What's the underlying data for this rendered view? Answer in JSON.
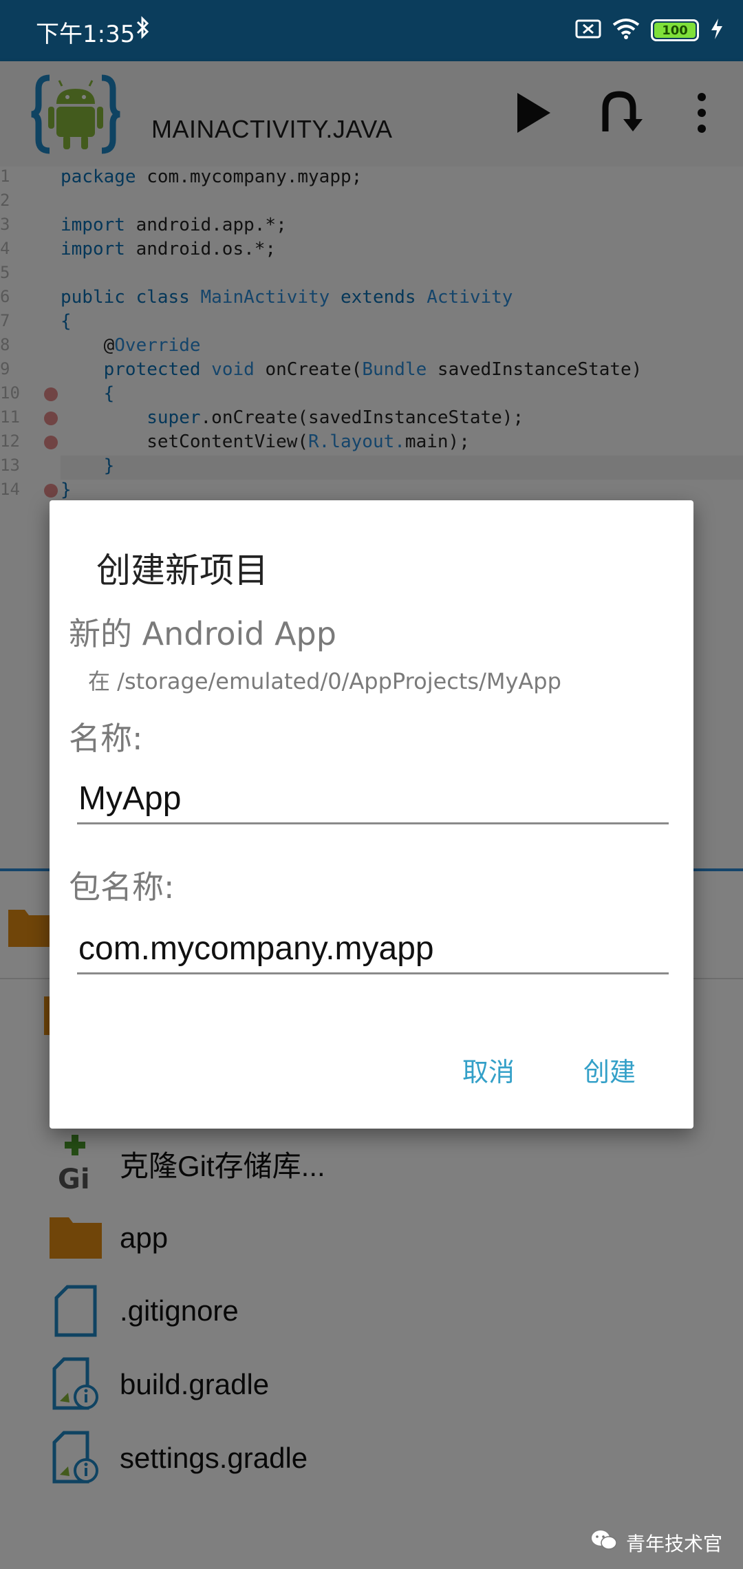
{
  "status_bar": {
    "time": "下午1:35",
    "battery": "100"
  },
  "toolbar": {
    "title": "MAINACTIVITY.JAVA"
  },
  "editor": {
    "line_numbers": [
      "1",
      "2",
      "3",
      "4",
      "5",
      "6",
      "7",
      "8",
      "9",
      "10",
      "11",
      "12",
      "13",
      "14"
    ]
  },
  "panel": {
    "items": [
      {
        "label": "克隆Git存储库..."
      },
      {
        "label": "app"
      },
      {
        "label": ".gitignore"
      },
      {
        "label": "build.gradle"
      },
      {
        "label": "settings.gradle"
      }
    ]
  },
  "dialog": {
    "title": "创建新项目",
    "subtitle": "新的 Android App",
    "path": "在 /storage/emulated/0/AppProjects/MyApp",
    "name_label": "名称:",
    "name_value": "MyApp",
    "package_label": "包名称:",
    "package_value": "com.mycompany.myapp",
    "cancel": "取消",
    "create": "创建"
  },
  "watermark": {
    "text": "青年技术官"
  },
  "colors": {
    "status_bar": "#0b3d5c",
    "accent": "#34a0c8",
    "keyword": "#0b6fb3"
  }
}
